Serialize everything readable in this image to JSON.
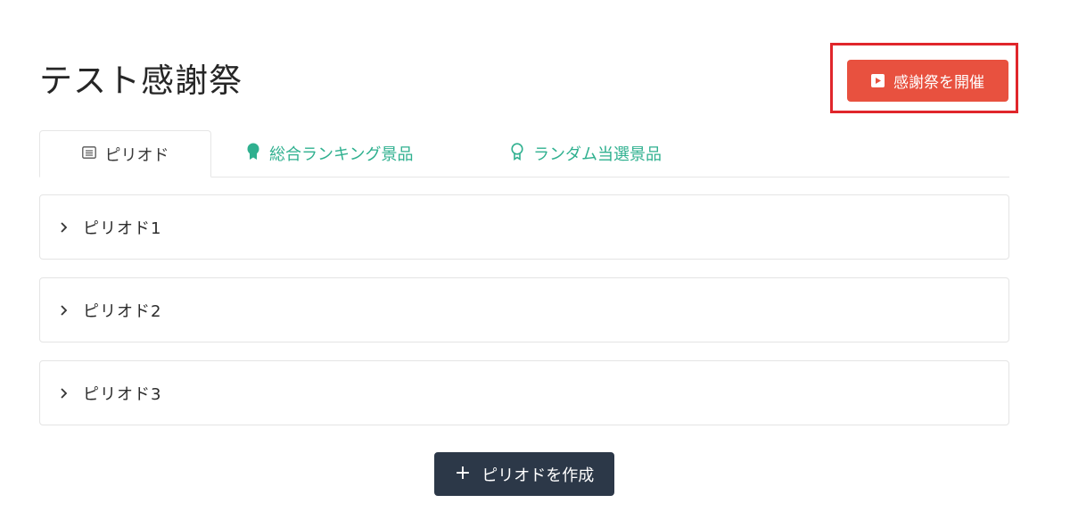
{
  "page": {
    "title": "テスト感謝祭"
  },
  "header": {
    "start_button_label": "感謝祭を開催",
    "highlight_color": "#e0262b",
    "button_color": "#e8513f"
  },
  "tabs": [
    {
      "label": "ピリオド",
      "icon": "list-icon",
      "active": true
    },
    {
      "label": "総合ランキング景品",
      "icon": "medal-icon",
      "active": false
    },
    {
      "label": "ランダム当選景品",
      "icon": "award-outline-icon",
      "active": false
    }
  ],
  "periods": [
    {
      "label": "ピリオド1",
      "icon": "chevron-right-icon"
    },
    {
      "label": "ピリオド2",
      "icon": "chevron-right-icon"
    },
    {
      "label": "ピリオド3",
      "icon": "chevron-right-icon"
    }
  ],
  "footer": {
    "create_button_label": "ピリオドを作成",
    "create_button_icon": "plus-icon",
    "button_color": "#2c3848"
  },
  "colors": {
    "accent_green": "#2fb08f"
  }
}
